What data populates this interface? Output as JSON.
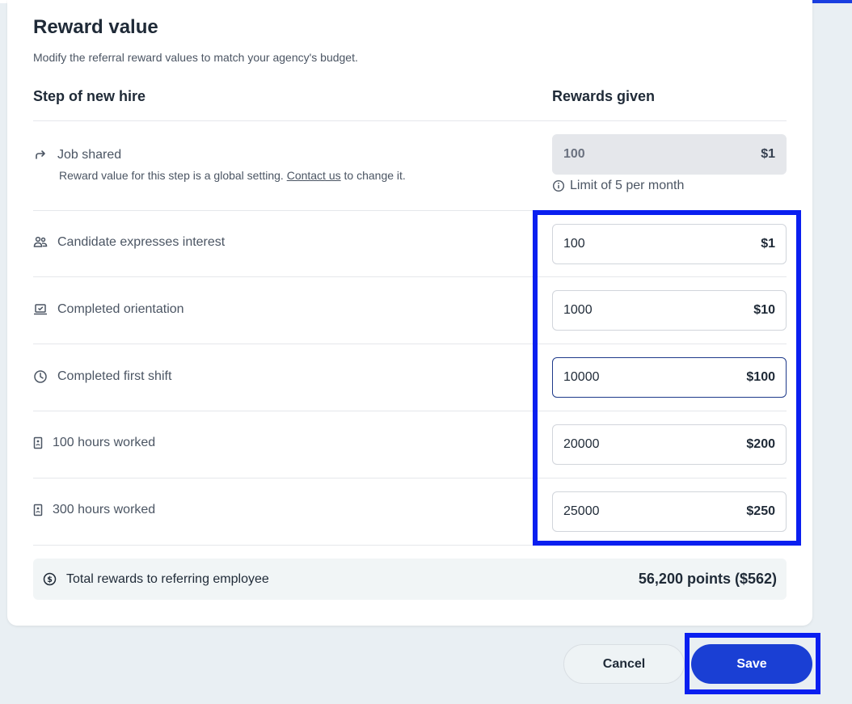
{
  "header": {
    "title": "Reward value",
    "subtitle": "Modify the referral reward values to match your agency's budget."
  },
  "columns": {
    "left": "Step of new hire",
    "right": "Rewards given"
  },
  "job_shared": {
    "label": "Job shared",
    "note_prefix": "Reward value for this step is a global setting.",
    "note_link": "Contact us",
    "note_suffix": "to change it.",
    "points": "100",
    "dollars": "$1",
    "limit": "Limit of 5 per month",
    "icon": "share-arrow-icon"
  },
  "steps": [
    {
      "label": "Candidate expresses interest",
      "points": "100",
      "dollars": "$1",
      "icon": "people-icon"
    },
    {
      "label": "Completed orientation",
      "points": "1000",
      "dollars": "$10",
      "icon": "laptop-check-icon"
    },
    {
      "label": "Completed first shift",
      "points": "10000",
      "dollars": "$100",
      "icon": "clock-icon"
    },
    {
      "label": "100 hours worked",
      "points": "20000",
      "dollars": "$200",
      "icon": "badge-icon"
    },
    {
      "label": "300 hours worked",
      "points": "25000",
      "dollars": "$250",
      "icon": "badge-icon"
    }
  ],
  "total": {
    "label": "Total rewards to referring employee",
    "value": "56,200 points ($562)",
    "icon": "dollar-circle-icon"
  },
  "actions": {
    "cancel": "Cancel",
    "save": "Save"
  },
  "colors": {
    "accent": "#1a3fd4",
    "highlight": "#0a1ff0"
  }
}
